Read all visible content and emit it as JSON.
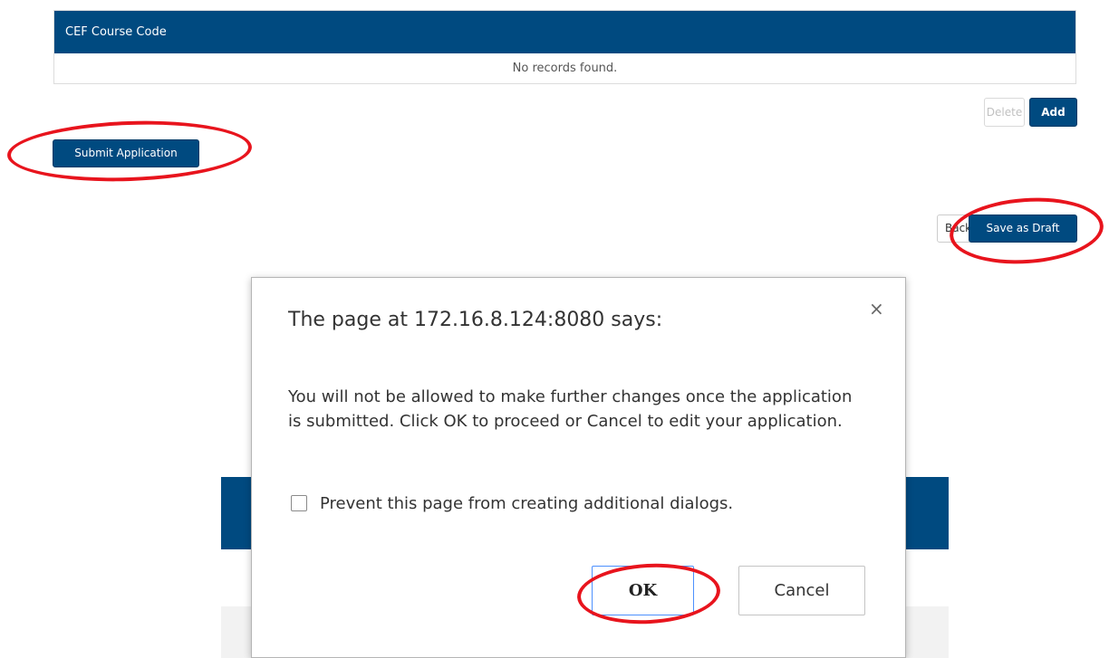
{
  "table": {
    "header": "CEF Course Code",
    "empty_message": "No records found."
  },
  "table_actions": {
    "delete_label": "Delete",
    "add_label": "Add"
  },
  "submit_label": "Submit Application",
  "footer_actions": {
    "back_label": "Back",
    "save_draft_label": "Save as Draft"
  },
  "dialog": {
    "title": "The page at 172.16.8.124:8080 says:",
    "close_glyph": "×",
    "message": "You will not be allowed to make further changes once the application is submitted. Click OK to proceed or Cancel to edit your application.",
    "checkbox_label": "Prevent this page from creating additional dialogs.",
    "ok_label": "OK",
    "cancel_label": "Cancel"
  },
  "colors": {
    "primary": "#004a80",
    "annotation": "#e8141d",
    "focus_ring": "#4d90fe"
  }
}
